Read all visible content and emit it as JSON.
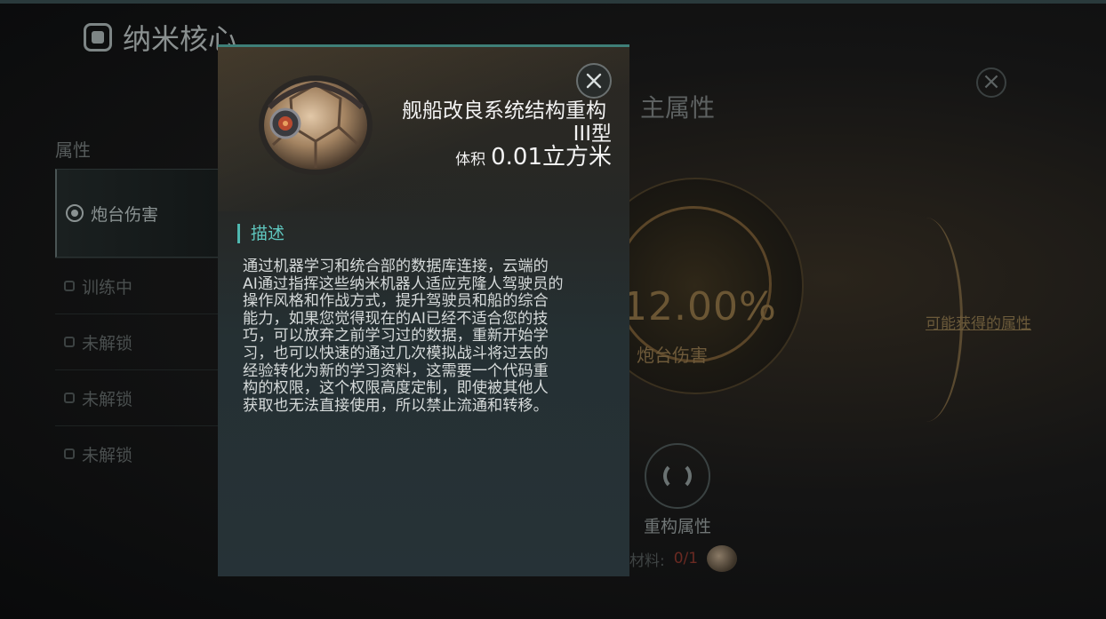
{
  "background": {
    "page_title": "纳米核心",
    "section_label": "属性",
    "attributes": [
      {
        "label": "炮台伤害",
        "state": "active"
      },
      {
        "label": "训练中",
        "state": "training"
      },
      {
        "label": "未解锁",
        "state": "locked"
      },
      {
        "label": "未解锁",
        "state": "locked"
      },
      {
        "label": "未解锁",
        "state": "locked"
      }
    ],
    "main_attr_title": "主属性",
    "main_value": "12.00%",
    "main_value_label": "炮台伤害",
    "possible_attrs_link": "可能获得的属性",
    "rebuild_label": "重构属性",
    "material_label": "材料:",
    "material_count": "0/1",
    "accent_color": "#6b5634"
  },
  "modal": {
    "item_name_line1": "舰船改良系统结构重构",
    "item_name_line2": "III型",
    "volume_label": "体积",
    "volume_value": "0.01立方米",
    "desc_heading": "描述",
    "description_lines": [
      "通过机器学习和统合部的数据库连接，云端的",
      "AI通过指挥这些纳米机器人适应克隆人驾驶员的",
      "操作风格和作战方式，提升驾驶员和船的综合",
      "能力，如果您觉得现在的AI已经不适合您的技",
      "巧，可以放弃之前学习过的数据，重新开始学",
      "习，也可以快速的通过几次模拟战斗将过去的",
      "经验转化为新的学习资料，这需要一个代码重",
      "构的权限，这个权限高度定制，即使被其他人",
      "获取也无法直接使用，所以禁止流通和转移。"
    ],
    "accent_color": "#4fb8b0",
    "close_icon": "close-icon"
  }
}
